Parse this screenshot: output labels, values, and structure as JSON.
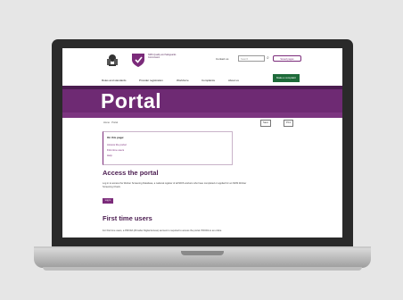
{
  "header": {
    "logo_text": "NDIS Quality and Safeguards Commission",
    "contact": "Contact us",
    "search_placeholder": "Search",
    "saved_pages": "Saved pages"
  },
  "nav": {
    "items": [
      "Rules and standards",
      "Provider registration",
      "Workforce",
      "Complaints",
      "About us"
    ],
    "cta": "Make a complaint"
  },
  "banner": {
    "title": "Portal"
  },
  "breadcrumb": "Home · Portal",
  "share": {
    "save": "Save",
    "print": "Print"
  },
  "toc": {
    "title": "On this page:",
    "links": [
      "Access the portal",
      "First time users",
      "Help"
    ]
  },
  "section1": {
    "heading": "Access the portal",
    "body": "Log in to access the Worker Screening Database, a national register of all NDIS workers who have completed or applied for an NDIS Worker Screening Check.",
    "button": "Log in"
  },
  "section2": {
    "heading": "First time users",
    "body": "For first time users, a PRODA (Provider Digital Access) account is required to access the portal. PRODA is an online"
  },
  "colors": {
    "brand": "#6e2a73",
    "cta": "#1e6b3a"
  }
}
